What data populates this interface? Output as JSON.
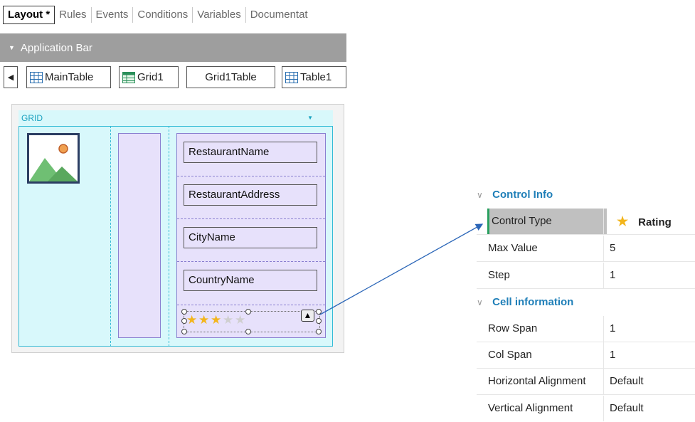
{
  "tabs": [
    {
      "label": "Layout *",
      "active": true
    },
    {
      "label": "Rules"
    },
    {
      "label": "Events"
    },
    {
      "label": "Conditions"
    },
    {
      "label": "Variables"
    },
    {
      "label": "Documentat"
    }
  ],
  "app_bar": {
    "label": "Application Bar"
  },
  "breadcrumb": {
    "back_icon": "chevron-left-icon",
    "items": [
      "MainTable",
      "Grid1",
      "Grid1Table",
      "Table1"
    ]
  },
  "grid": {
    "header_label": "GRID",
    "fields": [
      "RestaurantName",
      "RestaurantAddress",
      "CityName",
      "CountryName"
    ],
    "rating": {
      "filled": 3,
      "total": 5
    },
    "colors": {
      "grid_bg": "#d8f8fb",
      "grid_border": "#33bbd6",
      "table_bg": "#e7e1fb",
      "table_border": "#8a7fd0"
    }
  },
  "properties": {
    "sections": [
      {
        "title": "Control Info",
        "rows": [
          {
            "name": "Control Type",
            "value": "Rating",
            "icon": "star-icon",
            "selected": true
          },
          {
            "name": "Max Value",
            "value": "5"
          },
          {
            "name": "Step",
            "value": "1"
          }
        ]
      },
      {
        "title": "Cell information",
        "rows": [
          {
            "name": "Row Span",
            "value": "1"
          },
          {
            "name": "Col Span",
            "value": "1"
          },
          {
            "name": "Horizontal Alignment",
            "value": "Default"
          },
          {
            "name": "Vertical Alignment",
            "value": "Default"
          }
        ]
      }
    ],
    "accent_color": "#1f7fb8"
  }
}
